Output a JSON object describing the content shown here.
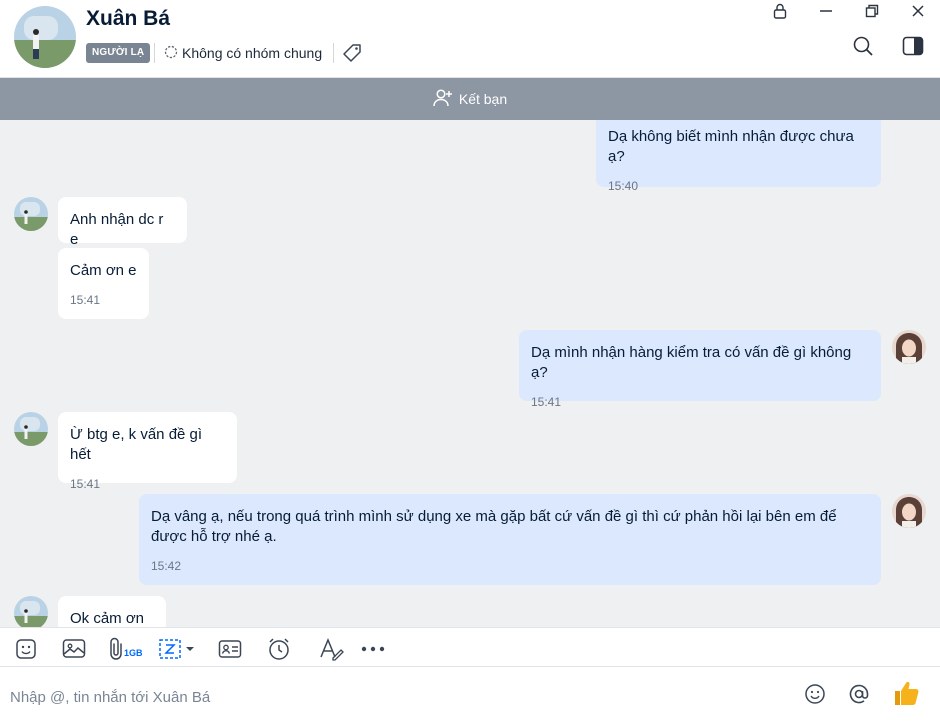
{
  "header": {
    "contact_name": "Xuân Bá",
    "stranger_badge": "NGƯỜI LẠ",
    "group_info": "Không có nhóm chung",
    "icons": [
      "lock-icon",
      "minimize-icon",
      "restore-icon",
      "close-icon",
      "search-icon",
      "panel-toggle-icon",
      "tag-icon"
    ]
  },
  "friend_bar": {
    "label": "Kết bạn"
  },
  "messages": [
    {
      "dir": "out",
      "text": "Dạ không biết mình nhận được chưa ạ?",
      "time": "15:40"
    },
    {
      "dir": "in",
      "text": "Anh nhận dc r e"
    },
    {
      "dir": "in",
      "text": "Cảm ơn e",
      "time": "15:41"
    },
    {
      "dir": "out",
      "text": "Dạ mình nhận hàng kiểm tra có vấn đề gì không ạ?",
      "time": "15:41"
    },
    {
      "dir": "in",
      "text": "Ừ btg e, k vấn đề gì hết",
      "time": "15:41"
    },
    {
      "dir": "out",
      "text": "Dạ vâng ạ, nếu trong quá trình mình sử dụng xe mà gặp bất cứ vấn đề gì thì cứ phản hồi lại bên em để được hỗ trợ nhé ạ.",
      "time": "15:42"
    },
    {
      "dir": "in",
      "text": "Ok cảm ơn e"
    }
  ],
  "toolbar": {
    "attach_limit": "1GB",
    "icons": [
      "sticker-icon",
      "image-icon",
      "paperclip-icon",
      "screenshot-icon",
      "contact-card-icon",
      "reminder-clock-icon",
      "text-format-icon",
      "more-icon"
    ]
  },
  "input": {
    "placeholder": "Nhập @, tin nhắn tới Xuân Bá",
    "value": ""
  },
  "colors": {
    "out_bubble": "#dbe8fe",
    "in_bubble": "#ffffff",
    "chat_bg": "#eef0f1",
    "friend_bar": "#8d96a3",
    "accent": "#0068ff",
    "thumb": "#f5b21b"
  }
}
